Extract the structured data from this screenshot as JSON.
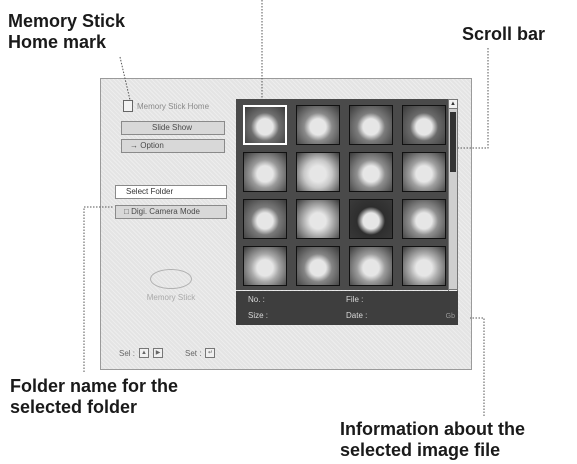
{
  "callouts": {
    "home_mark": [
      "Memory Stick",
      "Home mark"
    ],
    "scroll_bar": "Scroll bar",
    "folder_name": [
      "Folder name for the",
      "selected folder"
    ],
    "image_info": [
      "Information about the",
      "selected image file"
    ]
  },
  "screen": {
    "home_label": "Memory Stick Home",
    "menu": {
      "slide_show": "Slide Show",
      "option": "→ Option"
    },
    "folder": "Select Folder",
    "camera_mode": "Digi. Camera Mode",
    "logo_text": "Memory Stick",
    "status_bar": {
      "select_label": "Sel :",
      "set_label": "Set :",
      "select_keys": [
        "▲",
        "▶"
      ],
      "set_key": "↵"
    },
    "info": {
      "no_label": "No. :",
      "file_label": "File :",
      "size_label": "Size :",
      "date_label": "Date :",
      "end_mark": "Gb"
    },
    "scroll": {
      "up": "▲",
      "down": "▼"
    },
    "thumbnails": [
      {
        "tone": "#6f6f6f",
        "selected": true
      },
      {
        "tone": "#8a8a8a",
        "selected": false
      },
      {
        "tone": "#7d7d7d",
        "selected": false
      },
      {
        "tone": "#6a6a6a",
        "selected": false
      },
      {
        "tone": "#9a9a9a",
        "selected": false
      },
      {
        "tone": "#c8c8c8",
        "selected": false
      },
      {
        "tone": "#8f8f8f",
        "selected": false
      },
      {
        "tone": "#a0a0a0",
        "selected": false
      },
      {
        "tone": "#7a7a7a",
        "selected": false
      },
      {
        "tone": "#b5b5b5",
        "selected": false
      },
      {
        "tone": "#2e2e2e",
        "selected": false
      },
      {
        "tone": "#909090",
        "selected": false
      },
      {
        "tone": "#a8a8a8",
        "selected": false
      },
      {
        "tone": "#858585",
        "selected": false
      },
      {
        "tone": "#9c9c9c",
        "selected": false
      },
      {
        "tone": "#b0b0b0",
        "selected": false
      }
    ]
  }
}
